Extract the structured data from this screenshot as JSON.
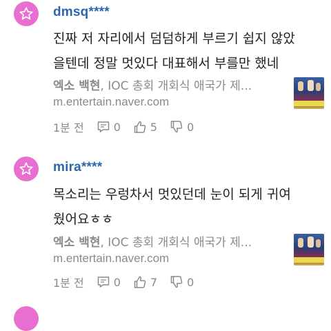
{
  "comments": [
    {
      "username": "dmsq****",
      "text_line1": "진짜 저 자리에서 덤덤하게 부르기 쉽지 않았",
      "text_line2": "을텐데 정말 멋있다 대표해서 부를만 했네",
      "link_title_bold": "엑소 백현",
      "link_title_rest": ", IOC 총회 개회식 애국가 제...",
      "link_url": "m.entertain.naver.com",
      "time": "1분 전",
      "replies": "0",
      "likes": "5",
      "dislikes": "0"
    },
    {
      "username": "mira****",
      "text_line1": "목소리는 우렁차서 멋있던데 눈이 되게 귀여",
      "text_line2": "웠어요ㅎㅎ",
      "link_title_bold": "엑소 백현",
      "link_title_rest": ", IOC 총회 개회식 애국가 제...",
      "link_url": "m.entertain.naver.com",
      "time": "1분 전",
      "replies": "0",
      "likes": "7",
      "dislikes": "0"
    }
  ],
  "colors": {
    "avatar": "#e86fd0",
    "username": "#2c66b0",
    "meta": "#8a8a8a"
  },
  "icons": [
    "star-icon",
    "reply-icon",
    "thumbs-up-icon",
    "thumbs-down-icon"
  ]
}
